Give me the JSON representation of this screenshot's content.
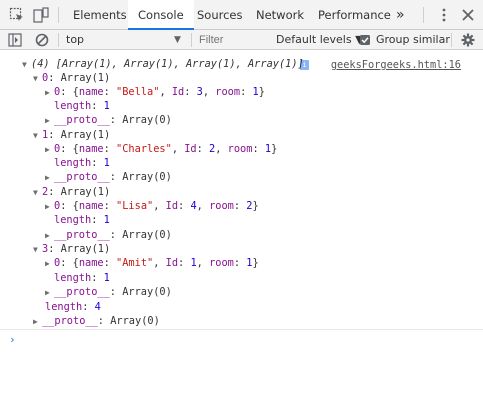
{
  "tabs": [
    {
      "label": "Elements"
    },
    {
      "label": "Console"
    },
    {
      "label": "Sources"
    },
    {
      "label": "Network"
    },
    {
      "label": "Performance"
    }
  ],
  "more_tabs_label": "»",
  "toolbar": {
    "context": "top",
    "filter_placeholder": "Filter",
    "levels": "Default levels ▼",
    "group_similar": "Group similar",
    "group_similar_checked": true
  },
  "console": {
    "summary": "(4) [Array(1), Array(1), Array(1), Array(1)]",
    "source": "geeksForgeeks.html:16",
    "groups": [
      {
        "index": "0",
        "label": "Array(1)",
        "name": "\"Bella\"",
        "id": "3",
        "room": "1"
      },
      {
        "index": "1",
        "label": "Array(1)",
        "name": "\"Charles\"",
        "id": "2",
        "room": "1"
      },
      {
        "index": "2",
        "label": "Array(1)",
        "name": "\"Lisa\"",
        "id": "4",
        "room": "2"
      },
      {
        "index": "3",
        "label": "Array(1)",
        "name": "\"Amit\"",
        "id": "1",
        "room": "1"
      }
    ],
    "inner_length": "1",
    "outer_length": "4",
    "proto_value": "Array(0)",
    "prompt": "›"
  },
  "colors": {
    "accent": "#1a73e8",
    "key": "#881391",
    "number": "#1c00cf",
    "string": "#c41a16"
  }
}
